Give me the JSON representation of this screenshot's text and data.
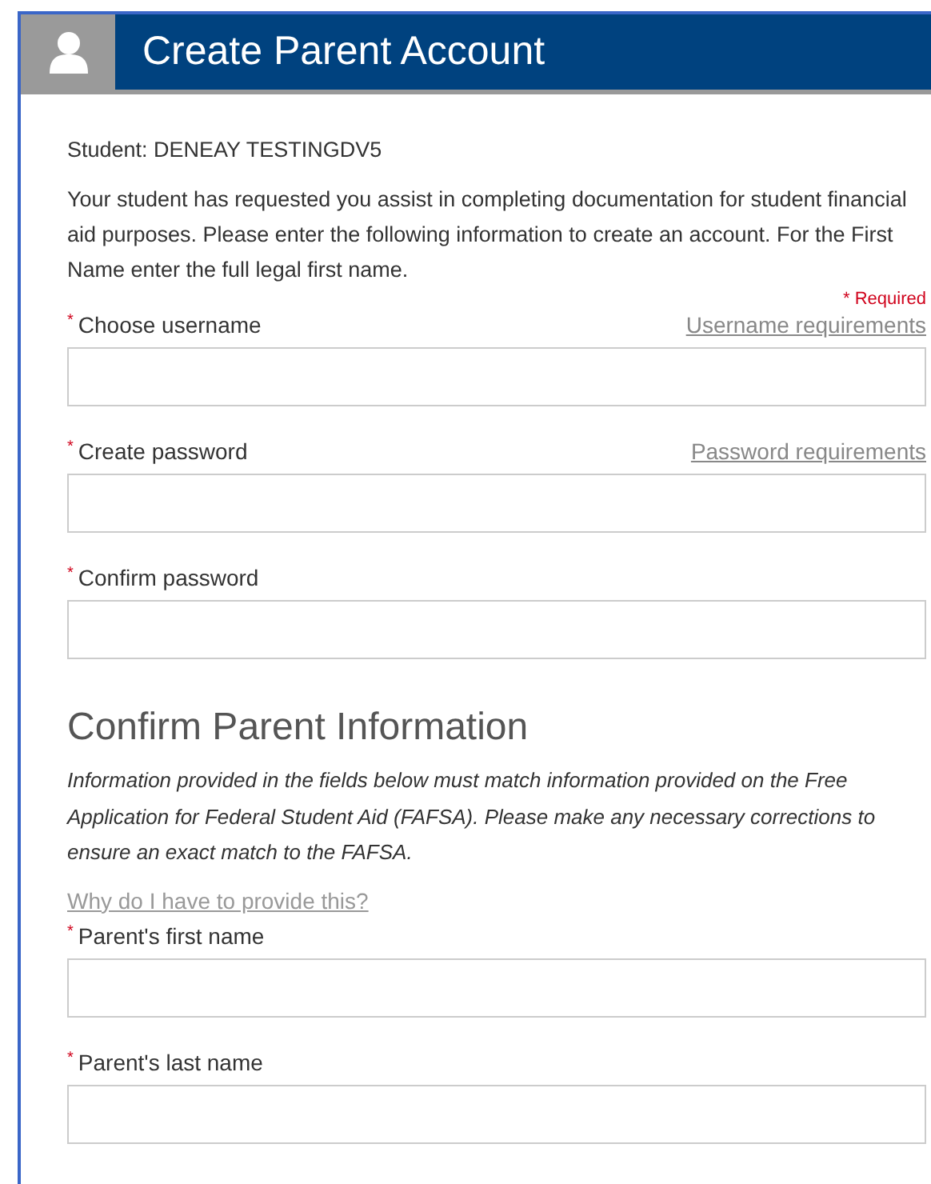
{
  "header": {
    "title": "Create Parent Account"
  },
  "student": "Student: DENEAY TESTINGDV5",
  "intro": "Your student has requested you assist in completing documentation for student financial aid purposes. Please enter the following information to create an account. For the First Name enter the full legal first name.",
  "required_note": "* Required",
  "account_fields": [
    {
      "mark": "*",
      "label": "Choose username",
      "link": "Username requirements"
    },
    {
      "mark": "*",
      "label": "Create password",
      "link": "Password requirements"
    },
    {
      "mark": "*",
      "label": "Confirm password"
    }
  ],
  "section": {
    "title": "Confirm Parent Information",
    "note": "Information provided in the fields below must match information provided on the Free Application for Federal Student Aid (FAFSA). Please make any necessary corrections to ensure an exact match to the FAFSA.",
    "help_link": "Why do I have to provide this?"
  },
  "parent_fields": [
    {
      "mark": "*",
      "label": "Parent's first name"
    },
    {
      "mark": "*",
      "label": "Parent's last name"
    }
  ]
}
